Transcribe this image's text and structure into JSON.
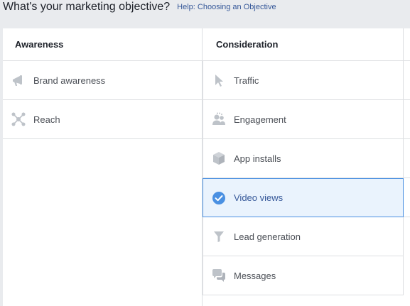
{
  "header": {
    "title": "What's your marketing objective?",
    "help_link": "Help: Choosing an Objective"
  },
  "columns": {
    "awareness": {
      "title": "Awareness",
      "items": [
        {
          "label": "Brand awareness",
          "icon": "megaphone-icon"
        },
        {
          "label": "Reach",
          "icon": "reach-icon"
        }
      ]
    },
    "consideration": {
      "title": "Consideration",
      "items": [
        {
          "label": "Traffic",
          "icon": "cursor-icon"
        },
        {
          "label": "Engagement",
          "icon": "people-icon"
        },
        {
          "label": "App installs",
          "icon": "box-icon"
        },
        {
          "label": "Video views",
          "icon": "checkmark-icon",
          "selected": true
        },
        {
          "label": "Lead generation",
          "icon": "funnel-icon"
        },
        {
          "label": "Messages",
          "icon": "chat-icon"
        }
      ]
    }
  },
  "colors": {
    "accent": "#4a90e2",
    "link": "#365899",
    "icon_gray": "#bec3c9",
    "selected_bg": "#eaf3fd"
  }
}
